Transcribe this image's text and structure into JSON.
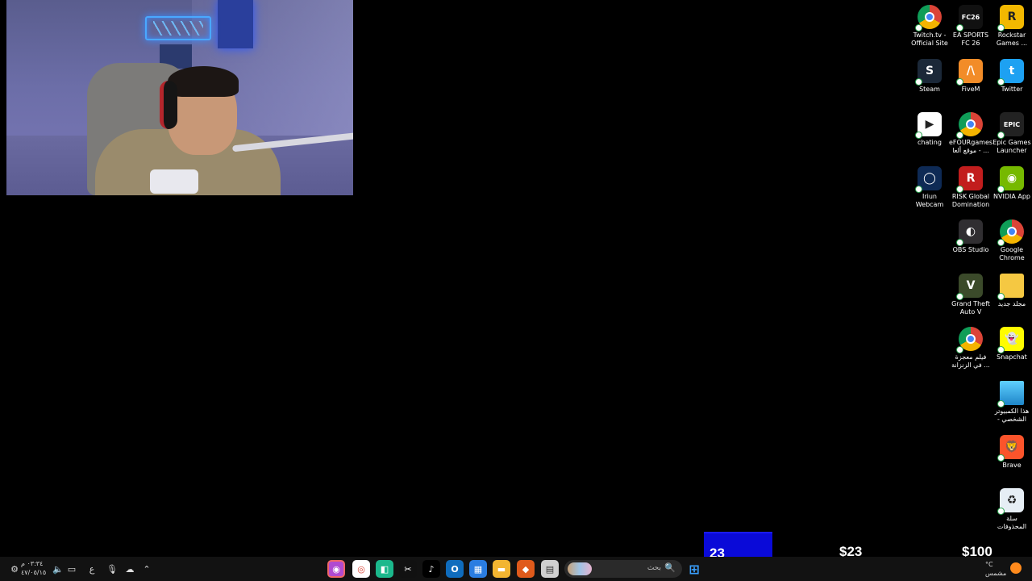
{
  "desktop": {
    "icons": [
      {
        "id": "twitch",
        "label": "Twitch.tv -\nOfficial Site",
        "icon": "chrome-shortcut-icon",
        "color": "#ffffff"
      },
      {
        "id": "fc26",
        "label": "EA SPORTS\nFC 26",
        "icon": "fc26-icon",
        "color": "#111111",
        "glyph": "FC26"
      },
      {
        "id": "rockstar",
        "label": "Rockstar\nGames ...",
        "icon": "rockstar-icon",
        "color": "#f2b800",
        "glyph": "R"
      },
      {
        "id": "steam",
        "label": "Steam",
        "icon": "steam-icon",
        "color": "#1b2838",
        "glyph": "S"
      },
      {
        "id": "fivem",
        "label": "FiveM",
        "icon": "fivem-icon",
        "color": "#f28c28",
        "glyph": "/\\"
      },
      {
        "id": "twitter",
        "label": "Twitter",
        "icon": "twitter-icon",
        "color": "#1da1f2",
        "glyph": "t"
      },
      {
        "id": "chating",
        "label": "chating",
        "icon": "chating-icon",
        "color": "#ffffff",
        "glyph": "▶"
      },
      {
        "id": "efour",
        "label": "eFOURgames\nموقع ألعا - ...",
        "icon": "chrome-shortcut-icon",
        "color": "#ffffff"
      },
      {
        "id": "epic",
        "label": "Epic Games\nLauncher",
        "icon": "epic-games-icon",
        "color": "#222222",
        "glyph": "EPIC"
      },
      {
        "id": "iriun",
        "label": "Iriun\nWebcam",
        "icon": "iriun-webcam-icon",
        "color": "#0e2a55",
        "glyph": "◯"
      },
      {
        "id": "risk",
        "label": "RISK Global\nDomination",
        "icon": "risk-icon",
        "color": "#c21d1d",
        "glyph": "R"
      },
      {
        "id": "nvidia",
        "label": "NVIDIA App",
        "icon": "nvidia-icon",
        "color": "#76b900",
        "glyph": "◉"
      },
      {
        "id": "obs",
        "label": "OBS Studio",
        "icon": "obs-icon",
        "color": "#302e31",
        "glyph": "◐"
      },
      {
        "id": "chrome",
        "label": "Google\nChrome",
        "icon": "chrome-icon",
        "color": "#ffffff"
      },
      {
        "id": "gta",
        "label": "Grand Theft\nAuto V",
        "icon": "gta-icon",
        "color": "#3b4a2a",
        "glyph": "V"
      },
      {
        "id": "newfolder",
        "label": "مجلد جديد",
        "icon": "folder-icon",
        "color": "#f5c842"
      },
      {
        "id": "film",
        "label": "فيلم معجزة\nفي الزنزانة ...",
        "icon": "chrome-shortcut-icon",
        "color": "#ffffff"
      },
      {
        "id": "snapchat",
        "label": "Snapchat",
        "icon": "snapchat-icon",
        "color": "#fffc00",
        "glyph": "👻"
      },
      {
        "id": "thispc",
        "label": "هذا الكمبيوتر\n- الشخصي",
        "icon": "monitor-icon",
        "color": "#3bb6e6"
      },
      {
        "id": "brave",
        "label": "Brave",
        "icon": "brave-icon",
        "color": "#fb542b",
        "glyph": "🦁"
      },
      {
        "id": "recycle",
        "label": "سلة\nالمحذوفات",
        "icon": "recycle-bin-icon",
        "color": "#e6eef5",
        "glyph": "♻"
      }
    ]
  },
  "overlay": {
    "counter": "23",
    "current_amount": "$23",
    "goal_amount": "$100"
  },
  "taskbar": {
    "clock_time": "٠٣:٣٤ م",
    "clock_date": "٤٧/٠٥/١٥",
    "language": "ع",
    "search_placeholder": "بحث",
    "weather_temp": "°C",
    "weather_text": "مشمس"
  }
}
